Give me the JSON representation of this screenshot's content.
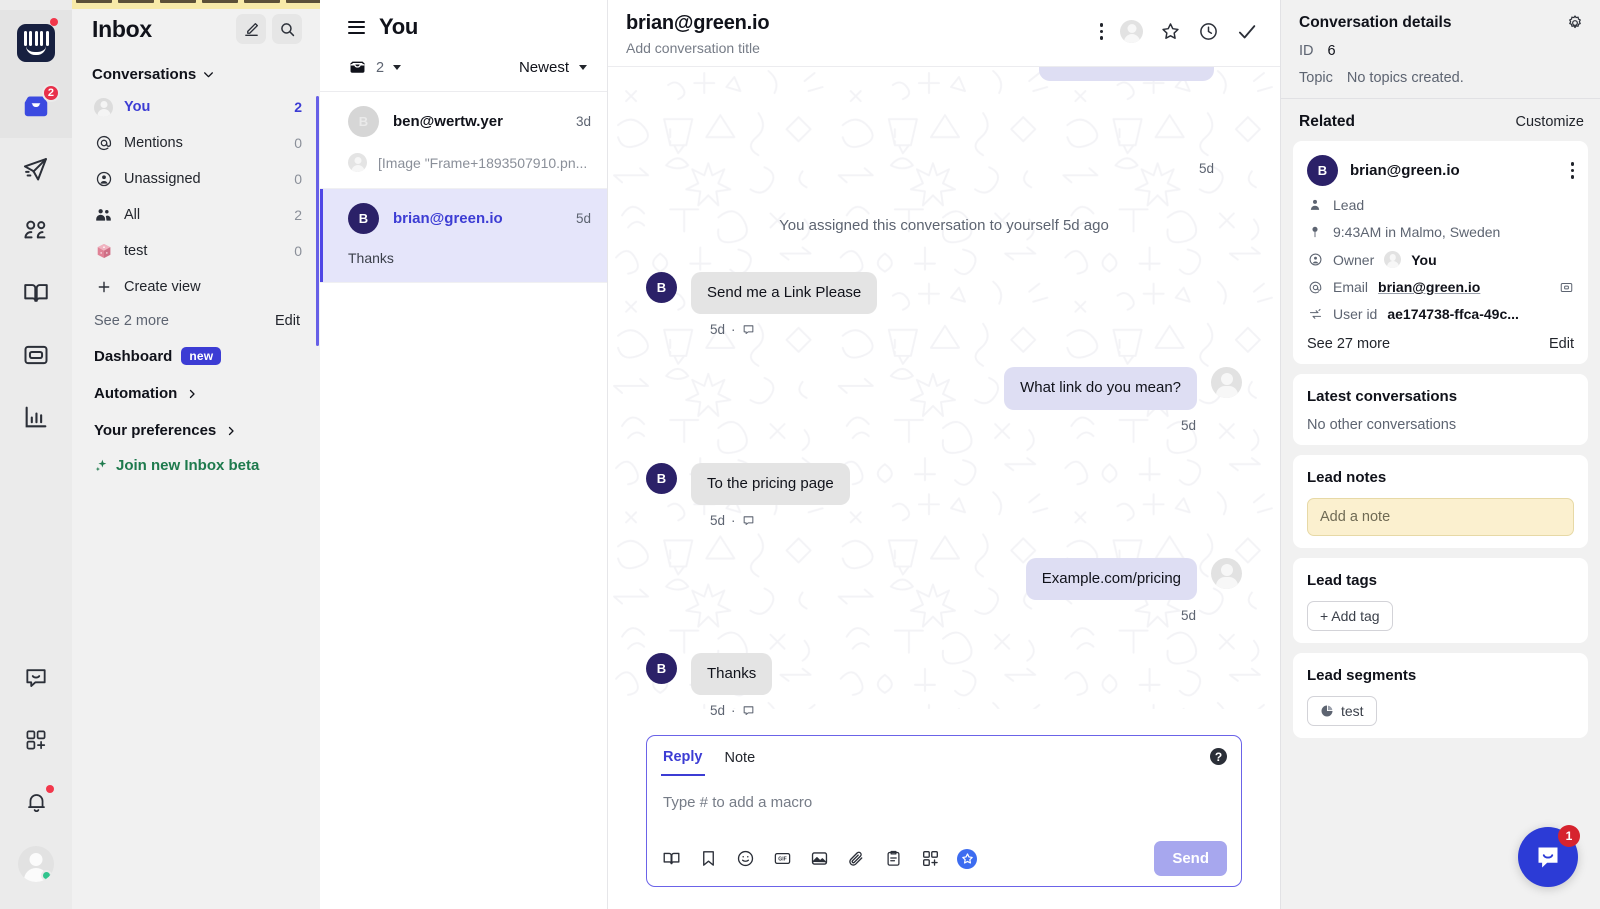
{
  "colors": {
    "brand_indigo": "#3c3cd4",
    "accent_blue": "#2c3bd6",
    "badge_red": "#e8304a",
    "bubble_inbound": "#e4e4e4",
    "bubble_outbound": "#dedef3",
    "note_yellow": "#fbf0cf",
    "beta_green": "#1e7a4d",
    "rail_bg": "#ebebeb",
    "nav_bg": "#f1f1f1",
    "avatar_dark": "#2b2168"
  },
  "rail": {
    "logo": {
      "name": "intercom-logo",
      "badge_dot": true
    },
    "items": [
      {
        "icon": "inbox-icon",
        "badge": "2",
        "active": true
      },
      {
        "icon": "paper-plane-icon",
        "badge": ""
      },
      {
        "icon": "contacts-icon",
        "badge": ""
      },
      {
        "icon": "book-open-icon",
        "badge": ""
      },
      {
        "icon": "news-icon",
        "badge": ""
      },
      {
        "icon": "reports-bar-chart-icon",
        "badge": ""
      }
    ],
    "bottom": [
      {
        "icon": "messenger-icon",
        "dot": false
      },
      {
        "icon": "apps-grid-icon",
        "dot": false
      },
      {
        "icon": "bell-icon",
        "dot": true
      }
    ],
    "avatar": {
      "name": "user-avatar",
      "online": true
    }
  },
  "nav": {
    "title": "Inbox",
    "compose_icon": "compose-icon",
    "search_icon": "search-icon",
    "section_label": "Conversations",
    "items": [
      {
        "label": "You",
        "count": "2",
        "icon": "avatar-icon",
        "selected": true
      },
      {
        "label": "Mentions",
        "count": "0",
        "icon": "at-icon",
        "selected": false
      },
      {
        "label": "Unassigned",
        "count": "0",
        "icon": "user-circle-icon",
        "selected": false
      },
      {
        "label": "All",
        "count": "2",
        "icon": "people-icon",
        "selected": false
      },
      {
        "label": "test",
        "count": "0",
        "icon": "dice-icon",
        "selected": false
      }
    ],
    "create_view": "Create view",
    "see_more": "See 2 more",
    "edit": "Edit",
    "links": [
      {
        "label": "Dashboard",
        "badge": "new",
        "chevron": false
      },
      {
        "label": "Automation",
        "badge": "",
        "chevron": true
      },
      {
        "label": "Your preferences",
        "badge": "",
        "chevron": true
      }
    ],
    "beta_label": "Join new Inbox beta",
    "beta_icon": "sparkles-icon"
  },
  "conversation_list": {
    "title": "You",
    "menu_icon": "hamburger-icon",
    "inbox_icon": "open-inbox-icon",
    "count": "2",
    "sort_label": "Newest",
    "items": [
      {
        "avatar_letter": "B",
        "name": "ben@wertw.yer",
        "time": "3d",
        "preview": "[Image \"Frame+1893507910.pn...",
        "preview_muted": true,
        "active": false
      },
      {
        "avatar_letter": "B",
        "name": "brian@green.io",
        "time": "5d",
        "preview": "Thanks",
        "preview_muted": false,
        "active": true
      }
    ]
  },
  "conversation": {
    "title": "brian@green.io",
    "subtitle": "Add conversation title",
    "actions": [
      {
        "icon": "more-vertical-icon"
      },
      {
        "icon": "assignee-avatar-icon"
      },
      {
        "icon": "star-icon"
      },
      {
        "icon": "snooze-clock-icon"
      },
      {
        "icon": "close-check-icon"
      }
    ],
    "cut_bubble_time": "5d",
    "system_note": "You assigned this conversation to yourself 5d ago",
    "messages": [
      {
        "side": "in",
        "text": "Send me a Link Please",
        "time": "5d",
        "has_channel_icon": true,
        "avatar_letter": "B"
      },
      {
        "side": "out",
        "text": "What link do you mean?",
        "time": "5d",
        "has_channel_icon": false,
        "avatar_letter": ""
      },
      {
        "side": "in",
        "text": "To the pricing page",
        "time": "5d",
        "has_channel_icon": true,
        "avatar_letter": "B"
      },
      {
        "side": "out",
        "text": "Example.com/pricing",
        "time": "5d",
        "has_channel_icon": false,
        "avatar_letter": ""
      },
      {
        "side": "in",
        "text": "Thanks",
        "time": "5d",
        "has_channel_icon": true,
        "avatar_letter": "B"
      }
    ]
  },
  "composer": {
    "tabs": [
      {
        "label": "Reply",
        "active": true
      },
      {
        "label": "Note",
        "active": false
      }
    ],
    "help_icon": "help-circle-icon",
    "placeholder": "Type # to add a macro",
    "tools": [
      {
        "icon": "book-open-icon"
      },
      {
        "icon": "saved-reply-icon"
      },
      {
        "icon": "emoji-icon"
      },
      {
        "icon": "gif-icon"
      },
      {
        "icon": "image-icon"
      },
      {
        "icon": "attachment-paperclip-icon"
      },
      {
        "icon": "clipboard-icon"
      },
      {
        "icon": "apps-grid-icon"
      },
      {
        "icon": "ai-star-icon"
      }
    ],
    "send_label": "Send"
  },
  "details": {
    "header_title": "Conversation details",
    "settings_icon": "gear-icon",
    "id_label": "ID",
    "id_value": "6",
    "topic_label": "Topic",
    "topic_value": "No topics created.",
    "related_label": "Related",
    "customize_label": "Customize",
    "lead": {
      "avatar_letter": "B",
      "name": "brian@green.io",
      "menu_icon": "more-vertical-icon",
      "attributes": [
        {
          "icon": "person-icon",
          "key": "Lead",
          "value": "",
          "tail": ""
        },
        {
          "icon": "location-icon",
          "key": "",
          "value": "9:43AM in Malmo, Sweden",
          "tail": ""
        },
        {
          "icon": "owner-icon",
          "key": "Owner",
          "value": "You",
          "tail": "",
          "has_avatar": true
        },
        {
          "icon": "at-icon",
          "key": "Email",
          "value": "brian@green.io",
          "tail": "copy-icon",
          "underline": true
        },
        {
          "icon": "user-id-icon",
          "key": "User id",
          "value": "ae174738-ffca-49c...",
          "tail": ""
        }
      ],
      "see_more": "See 27 more",
      "edit": "Edit"
    },
    "latest_conversations": {
      "title": "Latest conversations",
      "empty": "No other conversations"
    },
    "lead_notes": {
      "title": "Lead notes",
      "note_placeholder": "Add a note"
    },
    "lead_tags": {
      "title": "Lead tags",
      "add_label": "+ Add tag"
    },
    "lead_segments": {
      "title": "Lead segments",
      "chips": [
        {
          "label": "test",
          "icon": "segment-pie-icon"
        }
      ]
    }
  },
  "launcher": {
    "icon": "messenger-launcher-icon",
    "badge": "1"
  }
}
